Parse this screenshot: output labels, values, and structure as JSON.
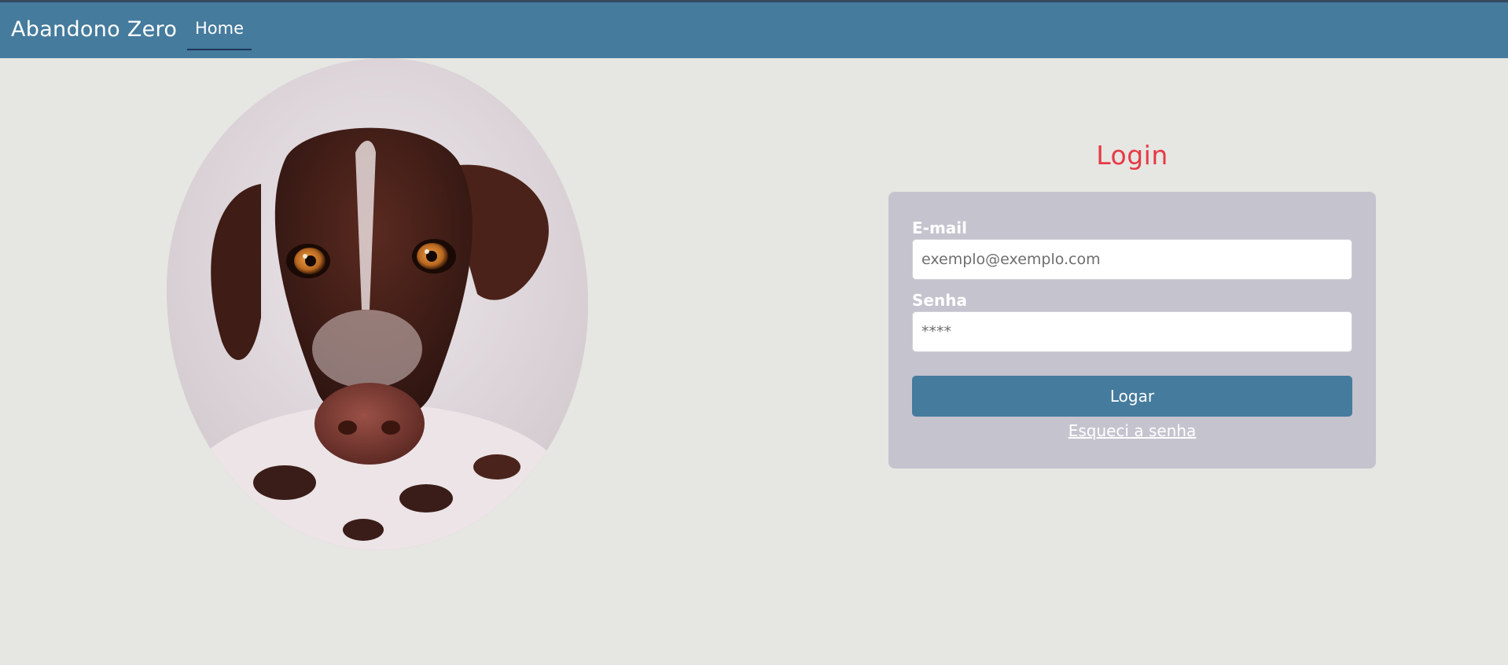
{
  "header": {
    "brand": "Abandono Zero",
    "nav_home": "Home"
  },
  "hero": {
    "image_subject": "dog-photo"
  },
  "login": {
    "title": "Login",
    "email_label": "E-mail",
    "email_placeholder": "exemplo@exemplo.com",
    "password_label": "Senha",
    "password_placeholder": "****",
    "submit_label": "Logar",
    "forgot_link": "Esqueci a senha"
  },
  "colors": {
    "navbar": "#457b9d",
    "page_background": "#e6e6e2",
    "card_background": "#c5c3ce",
    "title_accent": "#e63946",
    "button": "#457b9d"
  }
}
